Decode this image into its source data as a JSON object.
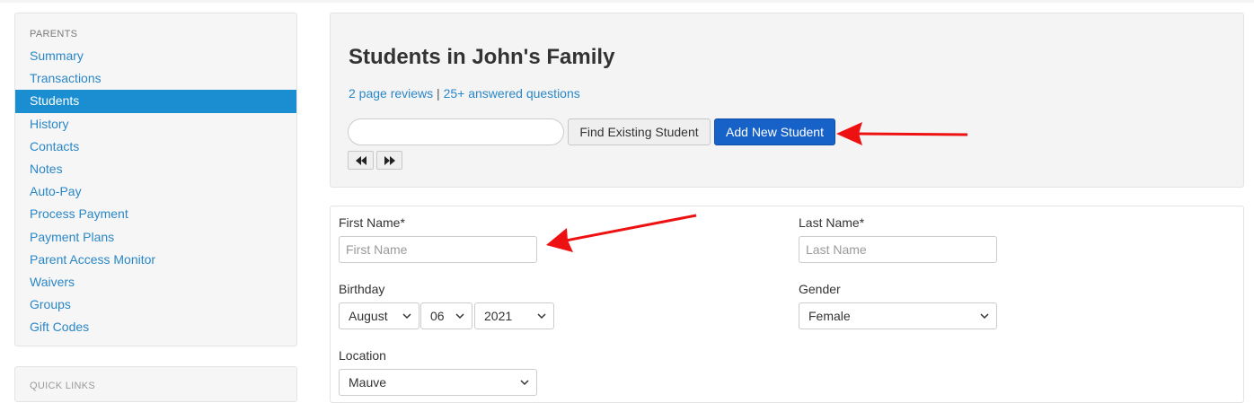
{
  "sidebar": {
    "section_title": "PARENTS",
    "items": [
      {
        "label": "Summary",
        "active": false
      },
      {
        "label": "Transactions",
        "active": false
      },
      {
        "label": "Students",
        "active": true
      },
      {
        "label": "History",
        "active": false
      },
      {
        "label": "Contacts",
        "active": false
      },
      {
        "label": "Notes",
        "active": false
      },
      {
        "label": "Auto-Pay",
        "active": false
      },
      {
        "label": "Process Payment",
        "active": false
      },
      {
        "label": "Payment Plans",
        "active": false
      },
      {
        "label": "Parent Access Monitor",
        "active": false
      },
      {
        "label": "Waivers",
        "active": false
      },
      {
        "label": "Groups",
        "active": false
      },
      {
        "label": "Gift Codes",
        "active": false
      }
    ],
    "quick_links_title": "QUICK LINKS"
  },
  "header": {
    "title": "Students in John's Family",
    "reviews_link": "2 page reviews",
    "separator": " | ",
    "questions_link": "25+ answered questions",
    "search_value": "",
    "find_button": "Find Existing Student",
    "add_button": "Add New Student",
    "prev_icon": "rewind-icon",
    "next_icon": "fast-forward-icon"
  },
  "form": {
    "first_name_label": "First Name*",
    "first_name_placeholder": "First Name",
    "last_name_label": "Last Name*",
    "last_name_placeholder": "Last Name",
    "birthday_label": "Birthday",
    "birthday_month": "August",
    "birthday_day": "06",
    "birthday_year": "2021",
    "gender_label": "Gender",
    "gender_value": "Female",
    "location_label": "Location",
    "location_value": "Mauve"
  },
  "colors": {
    "link": "#2a87c7",
    "active_nav_bg": "#1a8ed0",
    "primary_button": "#1762c8",
    "annotation_arrow": "#ee1111"
  }
}
